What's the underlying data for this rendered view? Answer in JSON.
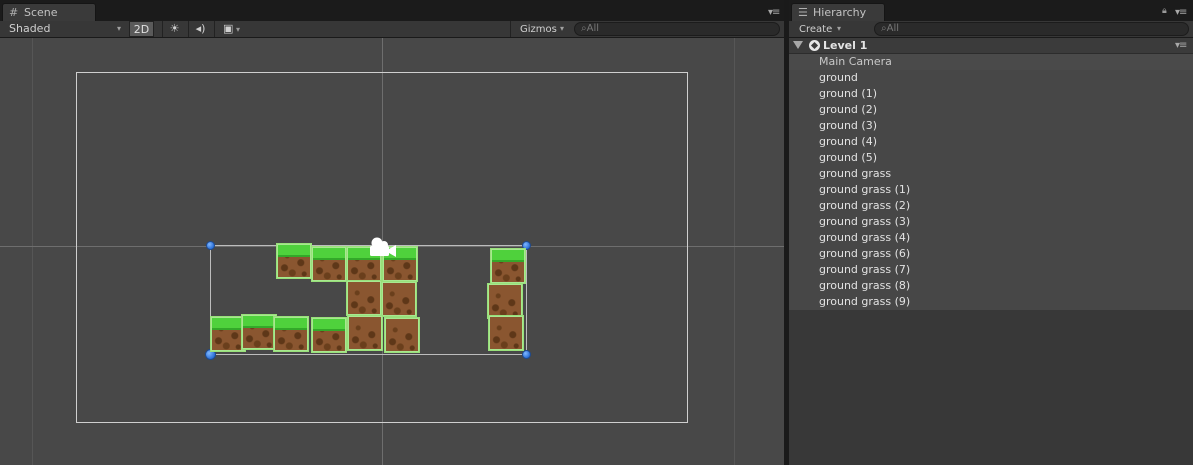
{
  "scene": {
    "tab_label": "Scene",
    "shading_mode": "Shaded",
    "mode_2d": "2D",
    "gizmos_label": "Gizmos",
    "search_placeholder": "All",
    "icons": [
      "grid-icon",
      "sun-icon",
      "audio-icon",
      "image-effects-icon"
    ]
  },
  "hierarchy": {
    "tab_label": "Hierarchy",
    "create_label": "Create",
    "search_placeholder": "All",
    "scene_name": "Level 1",
    "items": [
      "Main Camera",
      "ground",
      "ground (1)",
      "ground (2)",
      "ground (3)",
      "ground (4)",
      "ground (5)",
      "ground grass",
      "ground grass (1)",
      "ground grass (2)",
      "ground grass (3)",
      "ground grass (4)",
      "ground grass (6)",
      "ground grass (7)",
      "ground grass (8)",
      "ground grass (9)"
    ]
  },
  "colors": {
    "grass": "#4fd13c",
    "dirt": "#8a5630",
    "selection_outline": "#98e07a",
    "handle": "#2c6fd6"
  }
}
